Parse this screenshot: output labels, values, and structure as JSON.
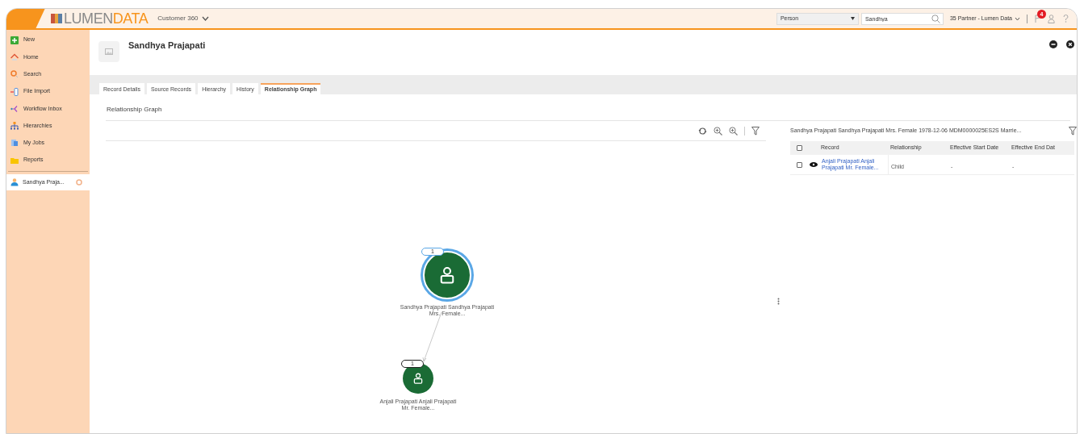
{
  "header": {
    "logo": [
      "LUMEN",
      "DATA"
    ],
    "app_menu": "Customer 360",
    "entity_select": "Person",
    "search_value": "Sandhya",
    "user_menu": "35 Partner - Lumen Data",
    "notification_count": "4"
  },
  "sidebar": {
    "items": [
      {
        "label": "New"
      },
      {
        "label": "Home"
      },
      {
        "label": "Search"
      },
      {
        "label": "File Import"
      },
      {
        "label": "Workflow Inbox"
      },
      {
        "label": "Hierarchies"
      },
      {
        "label": "My Jobs"
      },
      {
        "label": "Reports"
      }
    ],
    "open_records": [
      {
        "label": "Sandhya Praja...",
        "selected": true
      }
    ]
  },
  "record": {
    "title": "Sandhya Prajapati"
  },
  "tabs": [
    {
      "label": "Record Details",
      "selected": false
    },
    {
      "label": "Source Records",
      "selected": false
    },
    {
      "label": "Hierarchy",
      "selected": false
    },
    {
      "label": "History",
      "selected": false
    },
    {
      "label": "Relationship Graph",
      "selected": true
    }
  ],
  "section_title": "Relationship Graph",
  "graph": {
    "nodes": [
      {
        "badge": "1",
        "label": "Sandhya Prajapati Sandhya Prajapati Mrs. Female...",
        "selected": true
      },
      {
        "badge": "1",
        "label": "Anjali Prajapati Anjali Prajapati Mr. Female...",
        "selected": false
      }
    ]
  },
  "details": {
    "title": "Sandhya Prajapati Sandhya Prajapati Mrs. Female 1978-12-06 MDM0000025ES2S Marrie...",
    "select_all_checked": false,
    "columns": [
      "Record",
      "Relationship",
      "Effective Start Date",
      "Effective End Dat"
    ],
    "rows": [
      {
        "checked": false,
        "record": "Anjali Prajapati Anjali Prajapati Mr. Female...",
        "relationship": "Child",
        "start": "-",
        "end": "-"
      }
    ]
  }
}
